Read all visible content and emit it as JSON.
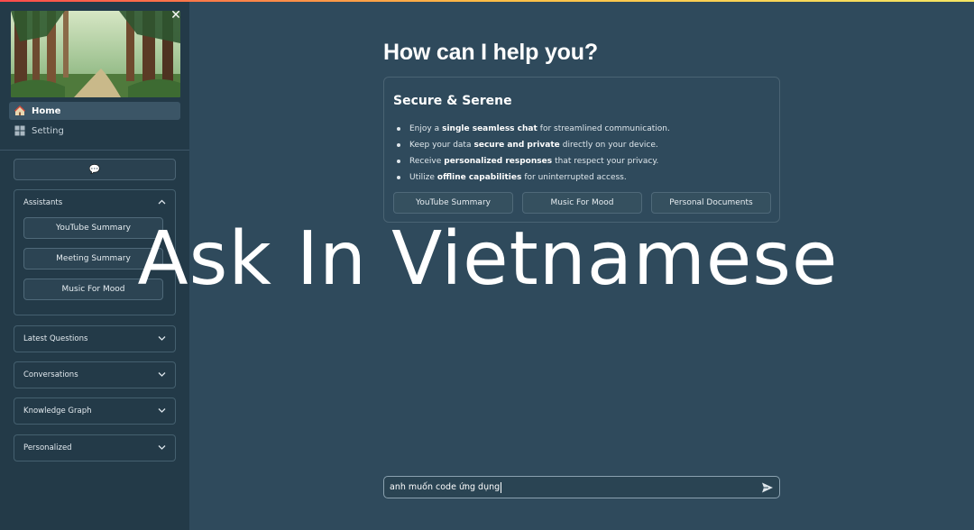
{
  "sidebar": {
    "close_glyph": "✕",
    "nav": [
      {
        "label": "Home",
        "icon": "house-icon",
        "active": true
      },
      {
        "label": "Setting",
        "icon": "grid-settings-icon",
        "active": false
      }
    ],
    "chat_icon": "💬",
    "assistants": {
      "title": "Assistants",
      "items": [
        "YouTube Summary",
        "Meeting Summary",
        "Music For Mood"
      ]
    },
    "sections": [
      "Latest Questions",
      "Conversations",
      "Knowledge Graph",
      "Personalized"
    ]
  },
  "main": {
    "title": "How can I help you?",
    "card": {
      "title": "Secure & Serene",
      "bullets": [
        {
          "pre": "Enjoy a",
          "bold": "single seamless chat",
          "post": "for streamlined communication."
        },
        {
          "pre": "Keep your data",
          "bold": "secure and private",
          "post": "directly on your device."
        },
        {
          "pre": "Receive",
          "bold": "personalized responses",
          "post": "that respect your privacy."
        },
        {
          "pre": "Utilize",
          "bold": "offline capabilities",
          "post": "for uninterrupted access."
        }
      ],
      "buttons": [
        "YouTube Summary",
        "Music For Mood",
        "Personal Documents"
      ]
    },
    "overlay_text": "Ask In Vietnamese",
    "input_value": "anh muốn code ứng dụng"
  },
  "colors": {
    "background": "#2f4a5c",
    "sidebar": "#233a48",
    "accent_gradient": [
      "#ff4b4b",
      "#ffbd45",
      "#f5e663"
    ]
  }
}
